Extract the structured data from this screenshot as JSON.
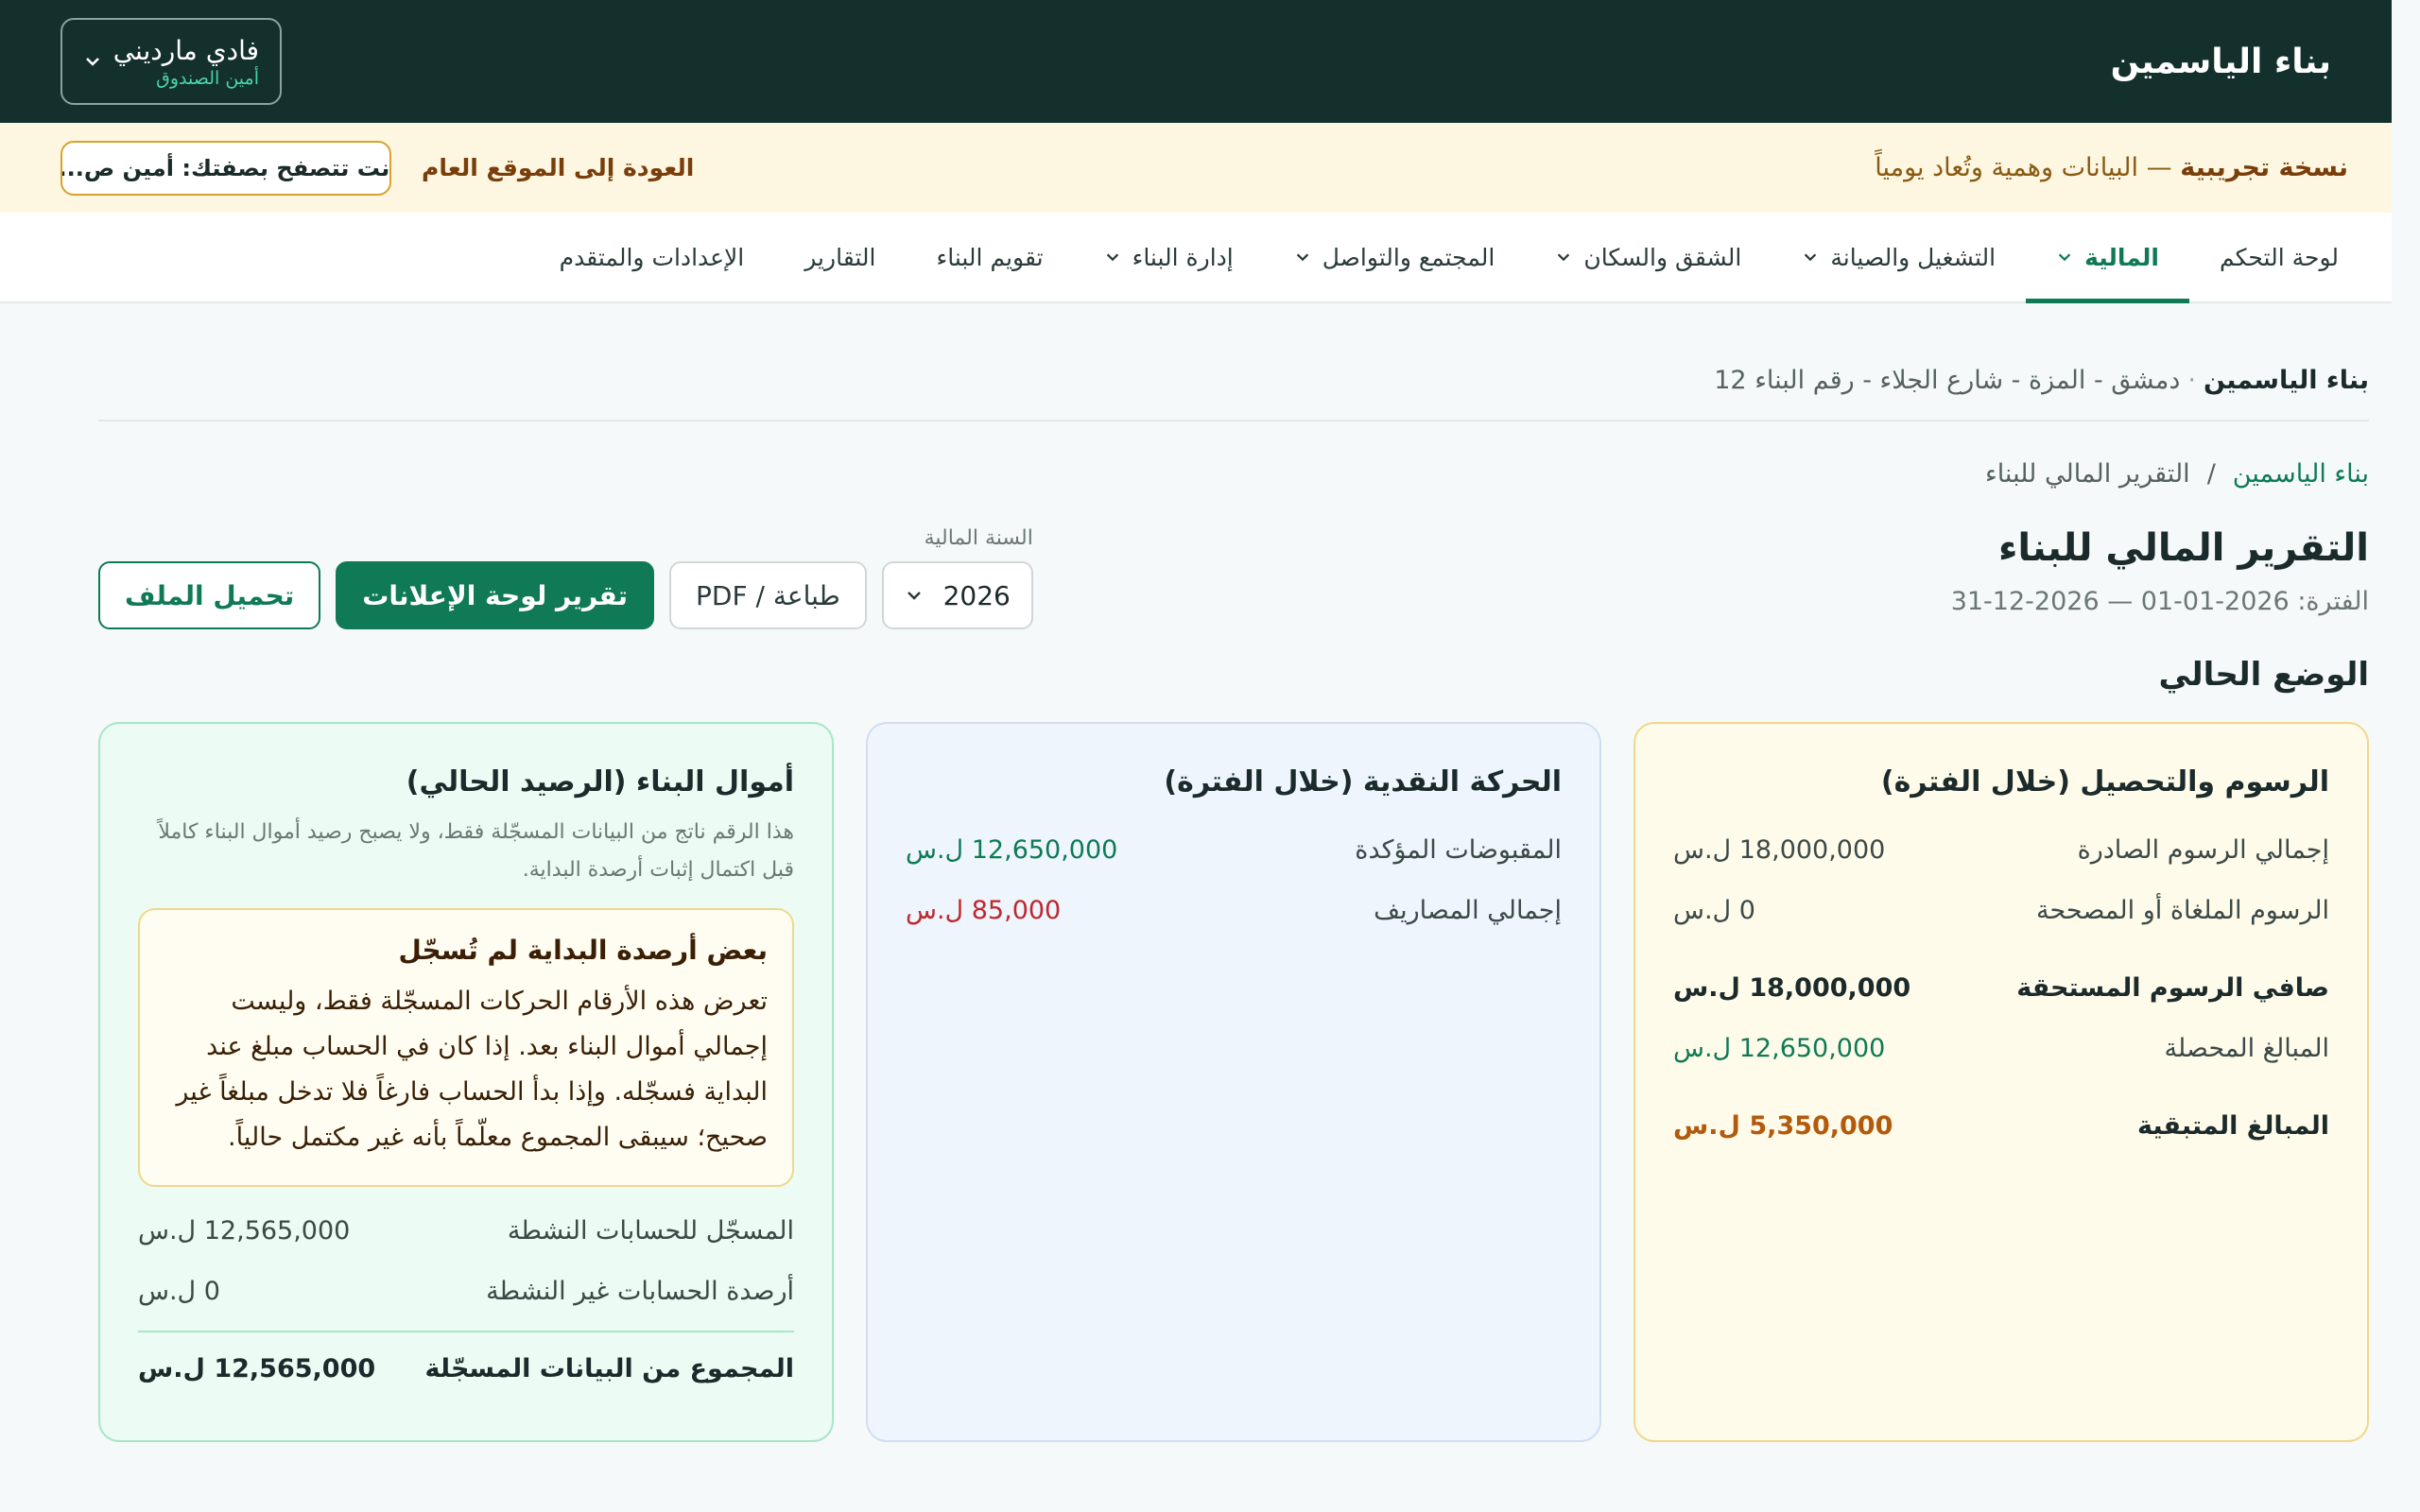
{
  "topbar": {
    "brand": "بناء الياسمين",
    "user_name": "فادي مارديني",
    "user_role": "أمين الصندوق"
  },
  "demo": {
    "bold": "نسخة تجريبية",
    "text": " — البيانات وهمية وتُعاد يومياً",
    "role_pill": "أنت تتصفح بصفتك: أمين ص...",
    "back_link": "العودة إلى الموقع العام"
  },
  "nav": {
    "items": [
      {
        "label": "لوحة التحكم"
      },
      {
        "label": "المالية"
      },
      {
        "label": "التشغيل والصيانة"
      },
      {
        "label": "الشقق والسكان"
      },
      {
        "label": "المجتمع والتواصل"
      },
      {
        "label": "إدارة البناء"
      },
      {
        "label": "تقويم البناء"
      },
      {
        "label": "التقارير"
      },
      {
        "label": "الإعدادات والمتقدم"
      }
    ]
  },
  "location": {
    "name": "بناء الياسمين",
    "separator": "·",
    "address": "دمشق - المزة - شارع الجلاء - رقم البناء 12"
  },
  "breadcrumb": {
    "root": "بناء الياسمين",
    "separator": "/",
    "current": "التقرير المالي للبناء"
  },
  "header": {
    "title": "التقرير المالي للبناء",
    "period": "الفترة: 2026-01-01 — 2026-12-31"
  },
  "actions": {
    "year_label": "السنة المالية",
    "year_value": "2026",
    "print": "طباعة / PDF",
    "bulletin": "تقرير لوحة الإعلانات",
    "download": "تحميل الملف"
  },
  "section_title": "الوضع الحالي",
  "fees_card": {
    "title": "الرسوم والتحصيل (خلال الفترة)",
    "issued_label": "إجمالي الرسوم الصادرة",
    "issued_value": "18,000,000 ل.س",
    "cancelled_label": "الرسوم الملغاة أو المصححة",
    "cancelled_value": "0 ل.س",
    "net_label": "صافي الرسوم المستحقة",
    "net_value": "18,000,000 ل.س",
    "collected_label": "المبالغ المحصلة",
    "collected_value": "12,650,000 ل.س",
    "remaining_label": "المبالغ المتبقية",
    "remaining_value": "5,350,000 ل.س"
  },
  "cash_card": {
    "title": "الحركة النقدية (خلال الفترة)",
    "receipts_label": "المقبوضات المؤكدة",
    "receipts_value": "12,650,000 ل.س",
    "expenses_label": "إجمالي المصاريف",
    "expenses_value": "85,000 ل.س"
  },
  "funds_card": {
    "title": "أموال البناء (الرصيد الحالي)",
    "note": "هذا الرقم ناتج من البيانات المسجّلة فقط، ولا يصبح رصيد أموال البناء كاملاً قبل اكتمال إثبات أرصدة البداية.",
    "warn_title": "بعض أرصدة البداية لم تُسجّل",
    "warn_body": "تعرض هذه الأرقام الحركات المسجّلة فقط، وليست إجمالي أموال البناء بعد. إذا كان في الحساب مبلغ عند البداية فسجّله. وإذا بدأ الحساب فارغاً فلا تدخل مبلغاً غير صحيح؛ سيبقى المجموع معلّماً بأنه غير مكتمل حالياً.",
    "active_label": "المسجّل للحسابات النشطة",
    "active_value": "12,565,000 ل.س",
    "inactive_label": "أرصدة الحسابات غير النشطة",
    "inactive_value": "0 ل.س",
    "total_label": "المجموع من البيانات المسجّلة",
    "total_value": "12,565,000 ل.س"
  },
  "colors": {
    "topbar": "#13302d",
    "accent": "#0f7a55",
    "banner": "#fdf7e2",
    "expense": "#c0262d",
    "remaining": "#b35a0c"
  }
}
